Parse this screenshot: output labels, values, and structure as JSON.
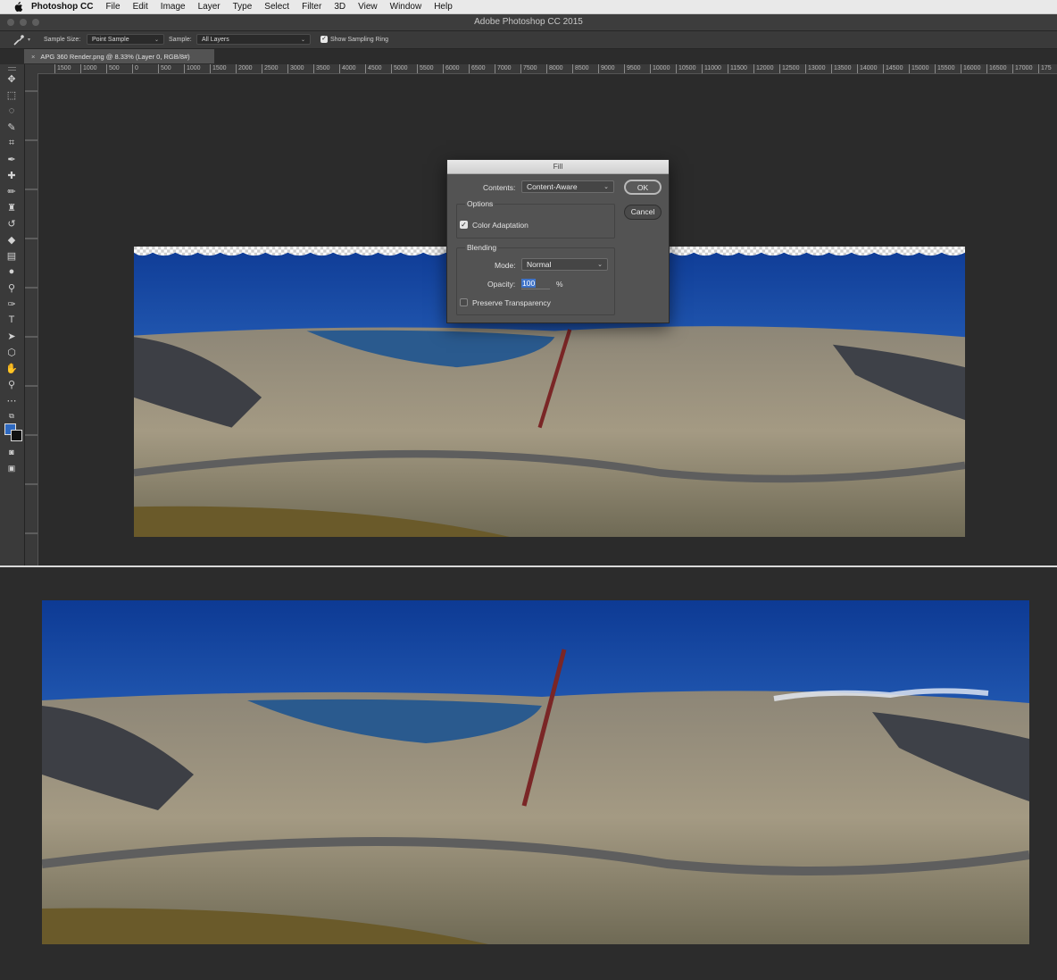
{
  "menubar": {
    "app_name": "Photoshop CC",
    "items": [
      "File",
      "Edit",
      "Image",
      "Layer",
      "Type",
      "Select",
      "Filter",
      "3D",
      "View",
      "Window",
      "Help"
    ]
  },
  "window": {
    "title": "Adobe Photoshop CC 2015"
  },
  "options_bar": {
    "tool_icon": "eyedropper-icon",
    "sample_size_label": "Sample Size:",
    "sample_size_value": "Point Sample",
    "sample_label": "Sample:",
    "sample_value": "All Layers",
    "sampling_ring_label": "Show Sampling Ring",
    "sampling_ring_checked": true
  },
  "document_tab": {
    "close_icon": "×",
    "title": "APG 360 Render.png @ 8.33% (Layer 0, RGB/8#)"
  },
  "ruler": {
    "labels": [
      "1500",
      "1000",
      "500",
      "0",
      "500",
      "1000",
      "1500",
      "2000",
      "2500",
      "3000",
      "3500",
      "4000",
      "4500",
      "5000",
      "5500",
      "6000",
      "6500",
      "7000",
      "7500",
      "8000",
      "8500",
      "9000",
      "9500",
      "10000",
      "10500",
      "11000",
      "11500",
      "12000",
      "12500",
      "13000",
      "13500",
      "14000",
      "14500",
      "15000",
      "15500",
      "16000",
      "16500",
      "17000",
      "175"
    ]
  },
  "tools": [
    {
      "name": "move-tool-icon",
      "glyph": "✥"
    },
    {
      "name": "marquee-tool-icon",
      "glyph": "⬚"
    },
    {
      "name": "lasso-tool-icon",
      "glyph": "◌"
    },
    {
      "name": "quick-select-tool-icon",
      "glyph": "✎"
    },
    {
      "name": "crop-tool-icon",
      "glyph": "⌗"
    },
    {
      "name": "eyedropper-tool-icon",
      "glyph": "✒"
    },
    {
      "name": "healing-brush-tool-icon",
      "glyph": "✚"
    },
    {
      "name": "brush-tool-icon",
      "glyph": "✏"
    },
    {
      "name": "clone-stamp-tool-icon",
      "glyph": "♜"
    },
    {
      "name": "history-brush-tool-icon",
      "glyph": "↺"
    },
    {
      "name": "eraser-tool-icon",
      "glyph": "◆"
    },
    {
      "name": "gradient-tool-icon",
      "glyph": "▤"
    },
    {
      "name": "blur-tool-icon",
      "glyph": "●"
    },
    {
      "name": "dodge-tool-icon",
      "glyph": "⚲"
    },
    {
      "name": "pen-tool-icon",
      "glyph": "✑"
    },
    {
      "name": "type-tool-icon",
      "glyph": "T"
    },
    {
      "name": "path-select-tool-icon",
      "glyph": "➤"
    },
    {
      "name": "shape-tool-icon",
      "glyph": "⬡"
    },
    {
      "name": "hand-tool-icon",
      "glyph": "✋"
    },
    {
      "name": "zoom-tool-icon",
      "glyph": "⚲"
    },
    {
      "name": "more-tools-icon",
      "glyph": "⋯"
    }
  ],
  "colors": {
    "foreground": "#2e69c0",
    "background": "#111111"
  },
  "fill_dialog": {
    "title": "Fill",
    "contents_label": "Contents:",
    "contents_value": "Content-Aware",
    "options_legend": "Options",
    "color_adaptation_label": "Color Adaptation",
    "color_adaptation_checked": true,
    "blending_legend": "Blending",
    "mode_label": "Mode:",
    "mode_value": "Normal",
    "opacity_label": "Opacity:",
    "opacity_value": "100",
    "opacity_unit": "%",
    "preserve_transparency_label": "Preserve Transparency",
    "preserve_transparency_checked": false,
    "ok_label": "OK",
    "cancel_label": "Cancel"
  }
}
